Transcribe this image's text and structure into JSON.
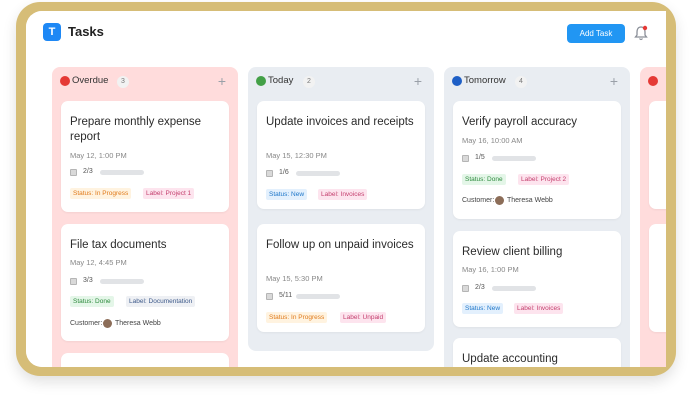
{
  "app": {
    "logo_letter": "T",
    "title": "Tasks"
  },
  "toolbar": {
    "add_task_label": "Add Task",
    "bell_icon": "bell-icon"
  },
  "columns": [
    {
      "name": "Overdue",
      "count": "3",
      "dot_color": "#e53935",
      "plus": "+",
      "cards": [
        {
          "title": "Prepare monthly expense report",
          "date": "May 12, 1:00 PM",
          "subtasks": "2/3",
          "progress": 0.67,
          "status": "Status: In Progress",
          "label": "Label: Project 1"
        },
        {
          "title": "File tax documents",
          "date": "May 12, 4:45 PM",
          "subtasks": "3/3",
          "progress": 1.0,
          "status": "Status: Done",
          "label": "Label: Documentation",
          "customer_label": "Customer:",
          "customer_name": "Theresa Webb"
        }
      ]
    },
    {
      "name": "Today",
      "count": "2",
      "dot_color": "#43a047",
      "plus": "+",
      "cards": [
        {
          "title": "Update invoices and receipts",
          "date": "May 15, 12:30 PM",
          "subtasks": "1/6",
          "progress": 0.17,
          "status": "Status: New",
          "label": "Label: Invoices"
        },
        {
          "title": "Follow up on unpaid invoices",
          "date": "May 15, 5:30 PM",
          "subtasks": "5/11",
          "progress": 0.45,
          "status": "Status: In Progress",
          "label": "Label: Unpaid"
        }
      ]
    },
    {
      "name": "Tomorrow",
      "count": "4",
      "dot_color": "#1e5fc6",
      "plus": "+",
      "cards": [
        {
          "title": "Verify payroll accuracy",
          "date": "May 16, 10:00 AM",
          "subtasks": "1/5",
          "progress": 0.2,
          "status": "Status: Done",
          "label": "Label: Project 2",
          "customer_label": "Customer:",
          "customer_name": "Theresa Webb"
        },
        {
          "title": "Review client billing",
          "date": "May 16, 1:00 PM",
          "subtasks": "2/3",
          "progress": 0.67,
          "status": "Status: New",
          "label": "Label: Invoices"
        },
        {
          "title": "Update accounting",
          "date": "",
          "subtasks": "",
          "progress": 0
        }
      ]
    },
    {
      "name": "",
      "dot_color": "#e53935"
    }
  ]
}
